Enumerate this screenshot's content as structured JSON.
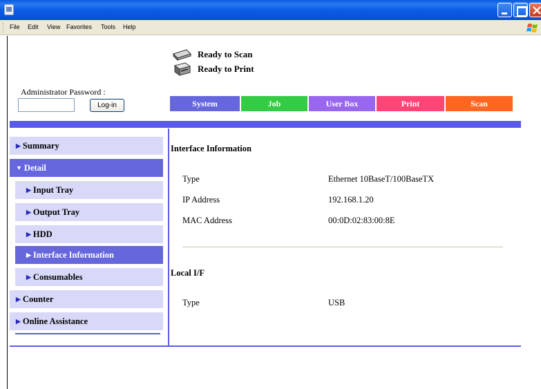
{
  "menubar": {
    "items": [
      "File",
      "Edit",
      "View",
      "Favorites",
      "Tools",
      "Help"
    ]
  },
  "status": {
    "scan": "Ready to Scan",
    "print": "Ready to Print"
  },
  "admin": {
    "label": "Administrator Password :",
    "login_label": "Log-in",
    "password_value": ""
  },
  "tabs": [
    {
      "label": "System",
      "color": "#6666dd"
    },
    {
      "label": "Job",
      "color": "#33cc44"
    },
    {
      "label": "User Box",
      "color": "#9966ee"
    },
    {
      "label": "Print",
      "color": "#ff4477"
    },
    {
      "label": "Scan",
      "color": "#ff6622"
    }
  ],
  "nav": {
    "items": [
      {
        "label": "Summary",
        "marker": "▶"
      },
      {
        "label": "Detail",
        "marker": "▼"
      },
      {
        "label": "Input Tray",
        "marker": "▶"
      },
      {
        "label": "Output Tray",
        "marker": "▶"
      },
      {
        "label": "HDD",
        "marker": "▶"
      },
      {
        "label": "Interface Information",
        "marker": "▶"
      },
      {
        "label": "Consumables",
        "marker": "▶"
      },
      {
        "label": "Counter",
        "marker": "▶"
      },
      {
        "label": "Online Assistance",
        "marker": "▶"
      }
    ]
  },
  "content": {
    "interface_title": "Interface Information",
    "interface_rows": [
      {
        "label": "Type",
        "value": "Ethernet 10BaseT/100BaseTX"
      },
      {
        "label": "IP Address",
        "value": "192.168.1.20"
      },
      {
        "label": "MAC Address",
        "value": "00:0D:02:83:00:8E"
      }
    ],
    "local_title": "Local I/F",
    "local_rows": [
      {
        "label": "Type",
        "value": "USB"
      }
    ]
  }
}
